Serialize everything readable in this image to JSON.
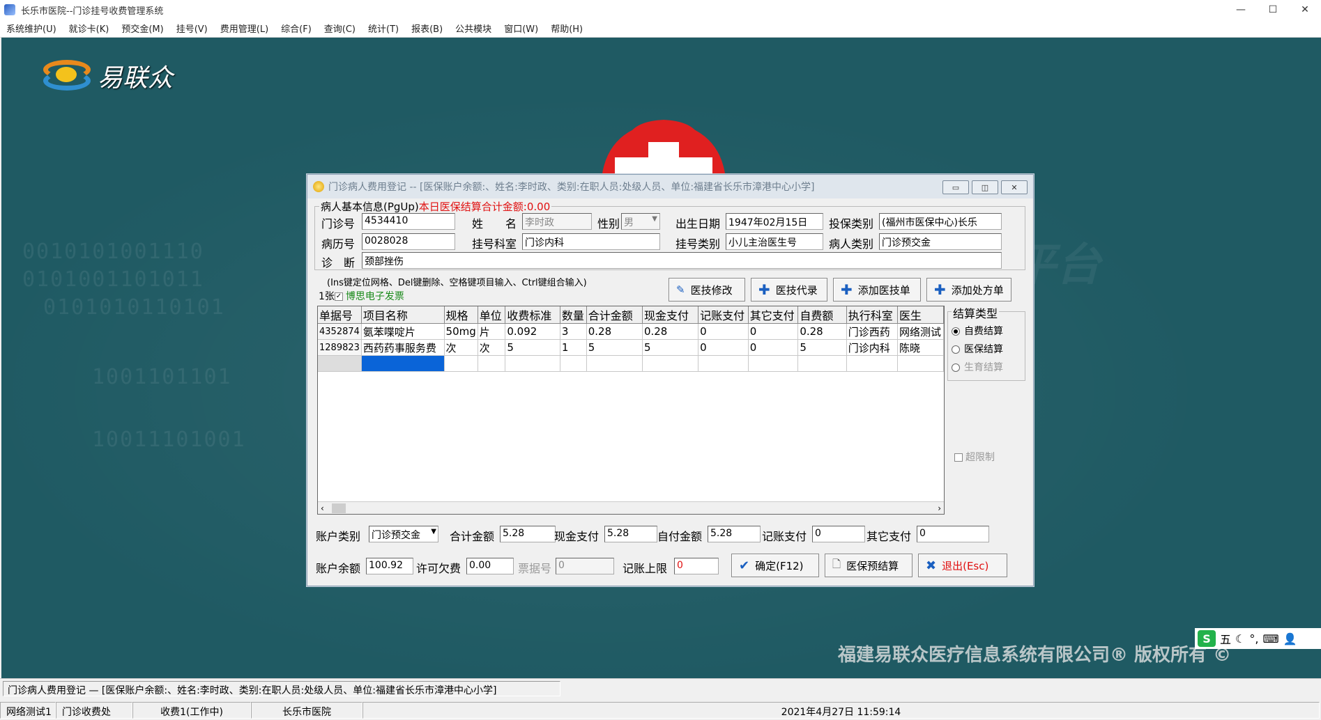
{
  "window": {
    "title": "长乐市医院--门诊挂号收费管理系统",
    "min": "—",
    "max": "☐",
    "close": "✕"
  },
  "menu": [
    "系统维护(U)",
    "就诊卡(K)",
    "预交金(M)",
    "挂号(V)",
    "费用管理(L)",
    "综合(F)",
    "查询(C)",
    "统计(T)",
    "报表(B)",
    "公共模块",
    "窗口(W)",
    "帮助(H)"
  ],
  "desktop": {
    "logo_text": "易联众",
    "binary_rows": [
      "0010101001110",
      "0101001101011",
      "0101010110101",
      "1001101101",
      "10011101001"
    ],
    "watermark": "息平台",
    "copyright": "福建易联众医疗信息系统有限公司® 版权所有 ©",
    "ime_mode": "五"
  },
  "dialog": {
    "title": "门诊病人费用登记 -- [医保账户余额:、姓名:李时政、类别:在职人员:处级人员、单位:福建省长乐市漳港中心小学]",
    "patient_group_title": "病人基本信息(PgUp)",
    "today_total_label": "本日医保结算合计金额:0.00",
    "labels": {
      "outpatient_no": "门诊号",
      "name": "姓　　名",
      "gender": "性别",
      "birth": "出生日期",
      "insurance_type": "投保类别",
      "record_no": "病历号",
      "reg_dept": "挂号科室",
      "reg_type": "挂号类别",
      "patient_type": "病人类别",
      "diagnosis": "诊　断"
    },
    "values": {
      "outpatient_no": "4534410",
      "name": "李时政",
      "gender": "男",
      "birth": "1947年02月15日",
      "insurance_type": "(福州市医保中心)长乐",
      "record_no": "0028028",
      "reg_dept": "门诊内科",
      "reg_type": "小儿主治医生号",
      "patient_type": "门诊预交金",
      "diagnosis": "颈部挫伤"
    },
    "hint": "(Ins键定位网格、Del键删除、空格键项目输入、Ctrl键组合输入)",
    "invoice_prefix": "1张",
    "invoice_label": "博思电子发票",
    "buttons": {
      "tech_edit": "医技修改",
      "tech_record": "医技代录",
      "add_tech": "添加医技单",
      "add_rx": "添加处方单",
      "confirm": "确定(F12)",
      "ins_pre": "医保预结算",
      "exit": "退出(Esc)"
    },
    "grid": {
      "headers": [
        "单据号",
        "项目名称",
        "规格",
        "单位",
        "收费标准",
        "数量",
        "合计金额",
        "现金支付",
        "记账支付",
        "其它支付",
        "自费额",
        "执行科室",
        "医生"
      ],
      "rows": [
        [
          "4352874",
          "氨苯喋啶片",
          "50mg",
          "片",
          "0.092",
          "3",
          "0.28",
          "0.28",
          "0",
          "0",
          "0.28",
          "门诊西药",
          "网络测试"
        ],
        [
          "1289823",
          "西药药事服务费",
          "次",
          "次",
          "5",
          "1",
          "5",
          "5",
          "0",
          "0",
          "5",
          "门诊内科",
          "陈晓"
        ]
      ]
    },
    "settle": {
      "title": "结算类型",
      "options": [
        "自费结算",
        "医保结算",
        "生育结算"
      ],
      "selected": "自费结算",
      "over_limit": "超限制"
    },
    "footer1": {
      "acct_type_label": "账户类别",
      "acct_type_value": "门诊预交金",
      "total_label": "合计金额",
      "total_value": "5.28",
      "cash_label": "现金支付",
      "cash_value": "5.28",
      "self_label": "自付金额",
      "self_value": "5.28",
      "account_label": "记账支付",
      "account_value": "0",
      "other_label": "其它支付",
      "other_value": "0"
    },
    "footer2": {
      "balance_label": "账户余额",
      "balance_value": "100.92",
      "overdraft_label": "许可欠费",
      "overdraft_value": "0.00",
      "ticket_label": "票据号",
      "ticket_value": "0",
      "limit_label": "记账上限",
      "limit_value": "0"
    }
  },
  "status": {
    "line1": "门诊病人费用登记 — [医保账户余额:、姓名:李时政、类别:在职人员:处级人员、单位:福建省长乐市漳港中心小学]",
    "items": [
      "网络测试1",
      "门诊收费处",
      "收费1(工作中)",
      "长乐市医院",
      "2021年4月27日 11:59:14"
    ]
  }
}
